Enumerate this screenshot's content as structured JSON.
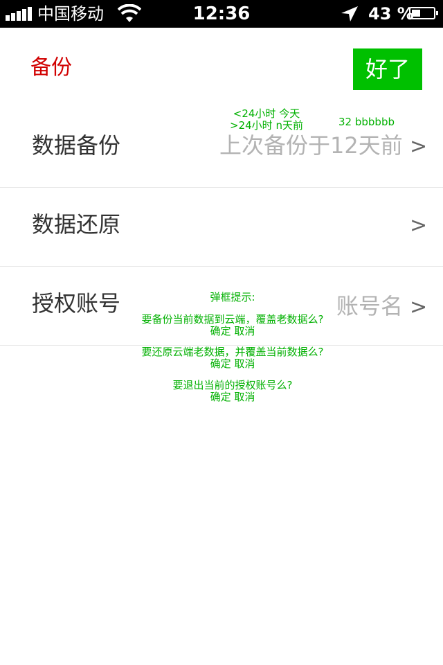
{
  "status_bar": {
    "carrier": "中国移动",
    "time": "12:36",
    "battery_percent": "43 %",
    "signal_bars": 5,
    "icons": [
      "signal-icon",
      "wifi-icon",
      "location-arrow-icon",
      "battery-icon"
    ],
    "battery_level": 0.43
  },
  "header": {
    "title": "备份",
    "done_label": "好了"
  },
  "rows": [
    {
      "label": "数据备份",
      "value": "上次备份于12天前",
      "chevron": ">"
    },
    {
      "label": "数据还原",
      "value": "",
      "chevron": ">"
    },
    {
      "label": "授权账号",
      "value": "账号名",
      "chevron": ">"
    }
  ],
  "annotations": {
    "time_rules": [
      "<24小时 今天",
      ">24小时 n天前"
    ],
    "font_spec": "32  bbbbbb",
    "dialog_title": "弹框提示:",
    "dialogs": [
      {
        "message": "要备份当前数据到云端，覆盖老数据么?",
        "actions": "确定  取消"
      },
      {
        "message": "要还原云端老数据，并覆盖当前数据么?",
        "actions": "确定  取消"
      },
      {
        "message": "要退出当前的授权账号么?",
        "actions": "确定  取消"
      }
    ]
  },
  "colors": {
    "status_bar_bg": "#000000",
    "title": "#d10000",
    "done_button_bg": "#00c000",
    "annotation": "#00b000",
    "row_value": "#b3b3b3"
  }
}
